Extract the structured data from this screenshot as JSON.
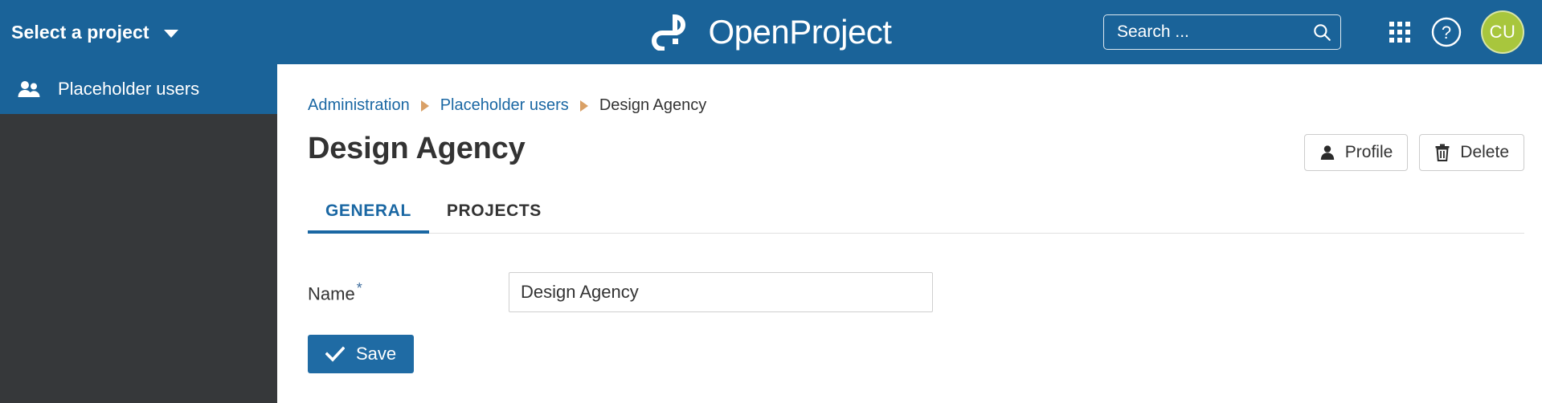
{
  "header": {
    "project_select_label": "Select a project",
    "logo_text": "OpenProject",
    "logo_icon": "openproject-logo-icon",
    "search": {
      "placeholder": "Search ...",
      "value": "",
      "icon": "search-icon"
    },
    "modules_icon": "grid-modules-icon",
    "help_icon": "help-circle-icon",
    "avatar_initials": "CU"
  },
  "sidebar": {
    "items": [
      {
        "label": "Placeholder users",
        "icon": "users-group-icon",
        "active": true
      }
    ]
  },
  "breadcrumb": {
    "items": [
      {
        "label": "Administration",
        "link": true
      },
      {
        "label": "Placeholder users",
        "link": true
      },
      {
        "label": "Design Agency",
        "link": false
      }
    ]
  },
  "page": {
    "title": "Design Agency",
    "actions": [
      {
        "label": "Profile",
        "icon": "person-icon"
      },
      {
        "label": "Delete",
        "icon": "trash-icon"
      }
    ],
    "tabs": [
      {
        "label": "GENERAL",
        "active": true
      },
      {
        "label": "PROJECTS",
        "active": false
      }
    ]
  },
  "form": {
    "name_label": "Name",
    "required_marker": "*",
    "name_value": "Design Agency",
    "name_placeholder": "",
    "save_label": "Save",
    "save_icon": "check-icon"
  },
  "colors": {
    "header_blue": "#1A6399",
    "sidebar_dark": "#36383A",
    "sidebar_active_blue": "#1A6399",
    "accent_blue": "#1A67A3",
    "primary_button": "#1F6BA4",
    "avatar_green": "#A8C63D",
    "breadcrumb_arrow": "#D9A066"
  }
}
